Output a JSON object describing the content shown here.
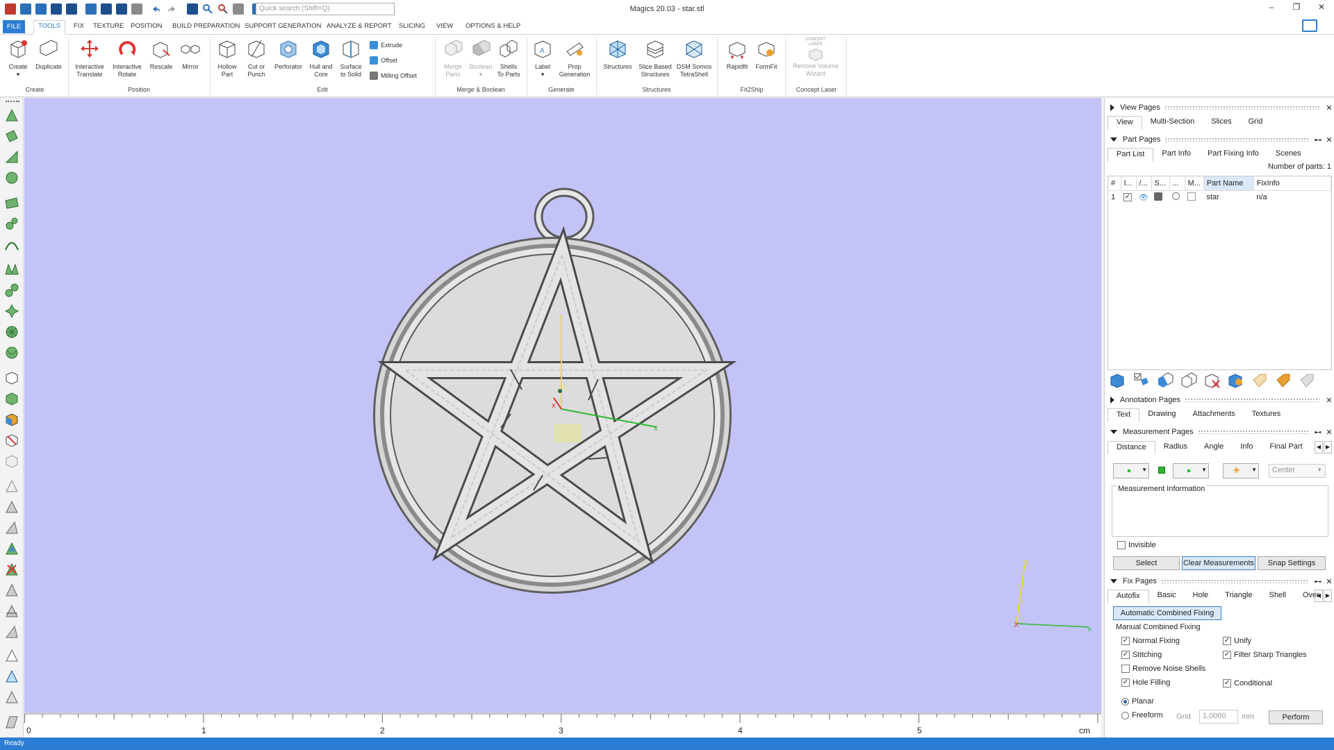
{
  "titlebar": {
    "title": "Magics 20.03 - star.stl",
    "search_placeholder": "Quick search (Shift+Q)"
  },
  "menu": {
    "tabs": [
      "FILE",
      "TOOLS",
      "FIX",
      "TEXTURE",
      "POSITION",
      "BUILD PREPARATION",
      "SUPPORT GENERATION",
      "ANALYZE & REPORT",
      "SLICING",
      "VIEW",
      "OPTIONS & HELP"
    ],
    "active": "TOOLS"
  },
  "ribbon": {
    "create": {
      "create": "Create",
      "duplicate": "Duplicate",
      "group": "Create"
    },
    "position": {
      "translate1": "Interactive",
      "translate2": "Translate",
      "rotate1": "Interactive",
      "rotate2": "Rotate",
      "rescale": "Rescale",
      "mirror": "Mirror",
      "group": "Position"
    },
    "edit": {
      "hollow1": "Hollow",
      "hollow2": "Part",
      "cut1": "Cut or",
      "cut2": "Punch",
      "perforator": "Perforator",
      "hull1": "Hull and",
      "hull2": "Core",
      "surface1": "Surface",
      "surface2": "to Solid",
      "extrude": "Extrude",
      "offset": "Offset",
      "milling": "Milling Offset",
      "group": "Edit"
    },
    "merge": {
      "merge1": "Merge",
      "merge2": "Parts",
      "boolean": "Boolean",
      "shells1": "Shells",
      "shells2": "To Parts",
      "group": "Merge & Boolean"
    },
    "generate": {
      "label": "Label",
      "prop1": "Prop",
      "prop2": "Generation",
      "group": "Generate"
    },
    "structures": {
      "structures": "Structures",
      "slice1": "Slice Based",
      "slice2": "Structures",
      "dsm1": "DSM Somos",
      "dsm2": "TetraShell",
      "group": "Structures"
    },
    "fit2ship": {
      "rapidfit": "Rapidfit",
      "formfit": "FormFit",
      "group": "Fit2Ship"
    },
    "concept": {
      "logo1": "CONCEPT",
      "logo2": "LASER",
      "remove1": "Remove Volume",
      "remove2": "Wizard",
      "group": "Concept Laser"
    }
  },
  "ruler": {
    "labels": [
      "0",
      "1",
      "2",
      "3",
      "4",
      "5"
    ],
    "unit": "cm"
  },
  "axes": {
    "x": "X",
    "y": "Y"
  },
  "view_pages": {
    "title": "View Pages",
    "tabs": [
      "View",
      "Multi-Section",
      "Slices",
      "Grid"
    ],
    "active": "View"
  },
  "part_pages": {
    "title": "Part Pages",
    "tabs": [
      "Part List",
      "Part Info",
      "Part Fixing Info",
      "Scenes"
    ],
    "active": "Part List",
    "count_label": "Number of parts: 1",
    "columns": [
      "#",
      "I...",
      "/...",
      "S...",
      "...",
      "M...",
      "Part Name",
      "FixInfo"
    ],
    "rows": [
      {
        "index": "1",
        "name": "star",
        "fixinfo": "n/a"
      }
    ]
  },
  "annotation_pages": {
    "title": "Annotation Pages",
    "tabs": [
      "Text",
      "Drawing",
      "Attachments",
      "Textures"
    ],
    "active": "Text"
  },
  "measurement_pages": {
    "title": "Measurement Pages",
    "tabs": [
      "Distance",
      "Radius",
      "Angle",
      "Info",
      "Final Part"
    ],
    "active": "Distance",
    "center": "Center",
    "info_label": "Measurement Information",
    "invisible": "Invisible",
    "select": "Select",
    "clear": "Clear Measurements",
    "snap": "Snap Settings"
  },
  "fix_pages": {
    "title": "Fix Pages",
    "tabs": [
      "Autofix",
      "Basic",
      "Hole",
      "Triangle",
      "Shell",
      "Over"
    ],
    "active": "Autofix",
    "auto_button": "Automatic Combined Fixing",
    "manual_label": "Manual Combined Fixing",
    "checks": [
      {
        "label": "Normal Fixing",
        "checked": true
      },
      {
        "label": "Unify",
        "checked": true
      },
      {
        "label": "Stitching",
        "checked": true
      },
      {
        "label": "Filter Sharp Triangles",
        "checked": true
      },
      {
        "label": "Remove Noise Shells",
        "checked": false
      },
      {
        "label": "Hole Filling",
        "checked": true
      },
      {
        "label": "Conditional",
        "checked": true
      }
    ],
    "planar": "Planar",
    "freeform": "Freeform",
    "grid_label": "Grid",
    "grid_value": "1,0000",
    "grid_unit": "mm",
    "perform": "Perform"
  },
  "status": {
    "text": "Ready"
  },
  "colors": {
    "viewport_bg": "#c3c3f7",
    "accent": "#2b7cd3",
    "model": "#d8d8d8"
  }
}
